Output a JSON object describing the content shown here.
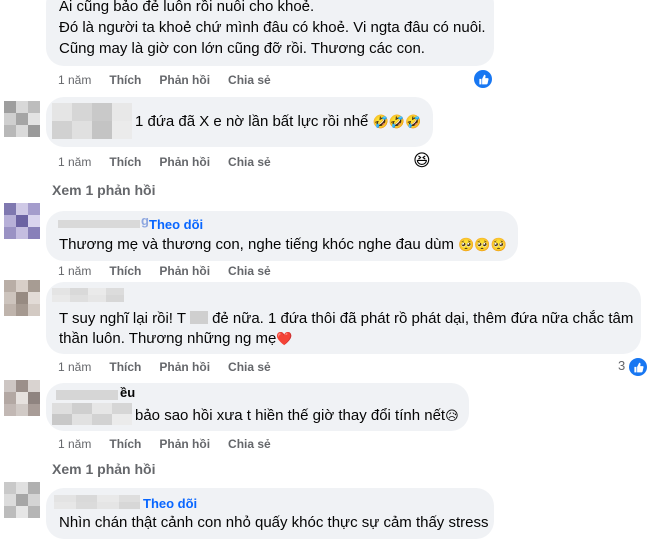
{
  "comments": [
    {
      "lines": [
        "Ai cũng bảo đẻ luôn rồi nuôi cho khoẻ.",
        "Đó là người ta khoẻ chứ mình đâu có khoẻ. Vi ngta đâu có nuôi.",
        "Cũng may là giờ con lớn cũng đỡ rồi. Thương các con."
      ],
      "time": "1 năm",
      "like": "Thích",
      "reply": "Phản hồi",
      "share": "Chia sẻ",
      "reaction_icon": "like-icon"
    },
    {
      "text": "1 đứa đã X e nờ lần bất lực rồi nhể",
      "emoji": "🤣🤣🤣",
      "time": "1 năm",
      "like": "Thích",
      "reply": "Phản hồi",
      "share": "Chia sẻ",
      "reaction_emoji": "😆",
      "view_replies": "Xem 1 phản hồi"
    },
    {
      "name_suffix": "g",
      "follow": "Theo dõi",
      "text": "Thương mẹ và thương con, nghe tiếng khóc nghe đau dùm",
      "emoji": "🥺🥺🥺",
      "time": "1 năm",
      "like": "Thích",
      "reply": "Phản hồi",
      "share": "Chia sẻ"
    },
    {
      "line1_a": "T suy nghĩ lại rồi! T",
      "line1_b": "đẻ nữa. 1 đứa thôi đã phát rồ phát dại, thêm đứa nữa chắc tâm",
      "line2": "thần luôn. Thương những ng mẹ",
      "heart": "❤️",
      "time": "1 năm",
      "like": "Thích",
      "reply": "Phản hồi",
      "share": "Chia sẻ",
      "reaction_count": "3",
      "reaction_icon": "like-icon"
    },
    {
      "name_suffix": "ều",
      "text": "bảo sao hồi xưa t hiền thế giờ thay đổi tính nết",
      "emoji": "😥",
      "time": "1 năm",
      "like": "Thích",
      "reply": "Phản hồi",
      "share": "Chia sẻ",
      "view_replies": "Xem 1 phản hồi"
    },
    {
      "follow": "Theo dõi",
      "text": "Nhìn chán thật cảnh con nhỏ quấy khóc thực sự cảm thấy stress"
    }
  ],
  "colors": {
    "bubble": "#f0f2f5",
    "meta": "#65676b",
    "accent": "#0866ff",
    "like": "#1877f2"
  }
}
